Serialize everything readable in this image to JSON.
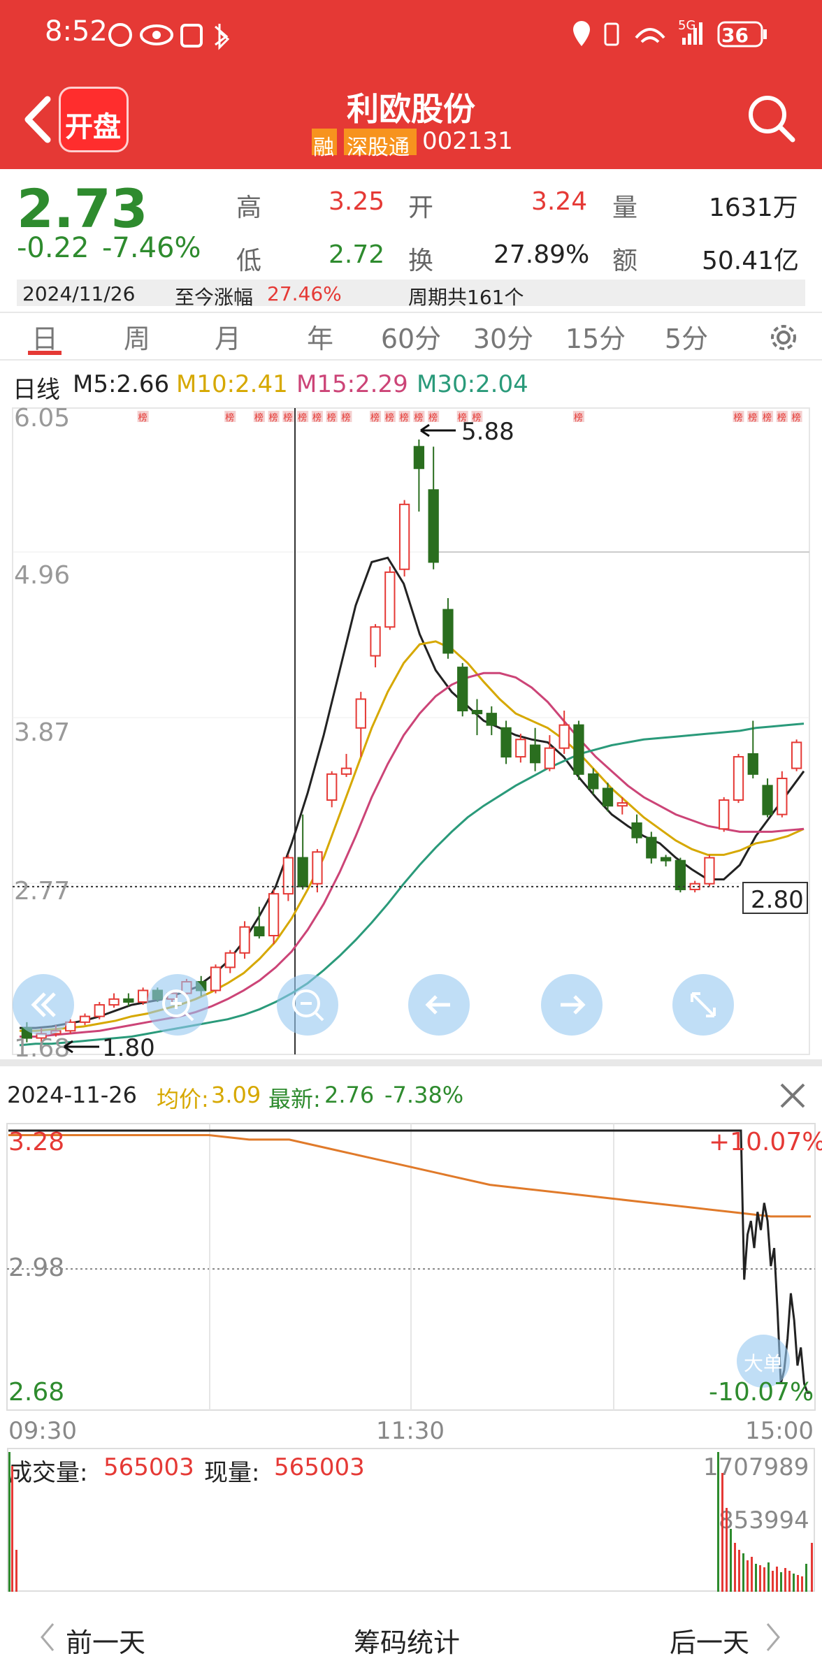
{
  "status_bar": {
    "time": "8:52",
    "battery": "36",
    "network": "5G"
  },
  "header": {
    "badge": "开盘",
    "stock_name": "利欧股份",
    "tag1": "融",
    "tag2": "深股通",
    "code": "002131"
  },
  "quote": {
    "price": "2.73",
    "change": "-0.22",
    "change_pct": "-7.46%",
    "high_label": "高",
    "high": "3.25",
    "open_label": "开",
    "open": "3.24",
    "vol_label": "量",
    "vol": "1631万",
    "low_label": "低",
    "low": "2.72",
    "turnover_label": "换",
    "turnover": "27.89%",
    "amount_label": "额",
    "amount": "50.41亿",
    "date": "2024/11/26",
    "gain_label": "至今涨幅",
    "gain": "27.46%",
    "period": "周期共161个"
  },
  "tabs": [
    "日",
    "周",
    "月",
    "年",
    "60分",
    "30分",
    "15分",
    "5分"
  ],
  "active_tab": "日",
  "ma_legend": {
    "type": "日线",
    "m5": "M5:2.66",
    "m10": "M10:2.41",
    "m15": "M15:2.29",
    "m30": "M30:2.04"
  },
  "colors": {
    "up": "#e53935",
    "down": "#2a6e1f",
    "m5": "#222222",
    "m10": "#d6a800",
    "m15": "#cc4477",
    "m30": "#2a9a7a",
    "header": "#e53935"
  },
  "kline_labels": {
    "hi_marker": "5.88",
    "lo_marker": "1.80",
    "current_box": "2.80",
    "bang": "榜"
  },
  "chart_data": [
    {
      "type": "candlestick",
      "title": "日线",
      "yticks": [
        "6.05",
        "4.96",
        "3.87",
        "2.77",
        "1.68"
      ],
      "ylim": [
        1.68,
        6.05
      ],
      "series": [
        {
          "name": "M5",
          "values": [
            1.82,
            1.82,
            1.83,
            1.85,
            1.87,
            1.9,
            1.94,
            1.98,
            2.0,
            2.02,
            2.06,
            2.1,
            2.18,
            2.28,
            2.42,
            2.6,
            2.8,
            3.1,
            3.45,
            3.85,
            4.3,
            4.75,
            5.05,
            5.08,
            4.9,
            4.55,
            4.3,
            4.15,
            4.05,
            3.95,
            3.9,
            3.85,
            3.82,
            3.8,
            3.7,
            3.55,
            3.42,
            3.3,
            3.22,
            3.15,
            3.1,
            3.0,
            2.92,
            2.85,
            2.85,
            2.95,
            3.15,
            3.3,
            3.45,
            3.6
          ]
        },
        {
          "name": "M10",
          "values": [
            1.8,
            1.8,
            1.81,
            1.82,
            1.83,
            1.85,
            1.87,
            1.9,
            1.92,
            1.95,
            1.98,
            2.02,
            2.07,
            2.13,
            2.2,
            2.3,
            2.42,
            2.58,
            2.78,
            3.0,
            3.3,
            3.6,
            3.9,
            4.15,
            4.35,
            4.48,
            4.5,
            4.45,
            4.35,
            4.22,
            4.1,
            4.0,
            3.95,
            3.9,
            3.82,
            3.72,
            3.6,
            3.48,
            3.38,
            3.28,
            3.2,
            3.12,
            3.06,
            3.02,
            3.02,
            3.05,
            3.1,
            3.12,
            3.15,
            3.2
          ]
        },
        {
          "name": "M15",
          "values": [
            1.76,
            1.76,
            1.77,
            1.78,
            1.79,
            1.8,
            1.82,
            1.84,
            1.86,
            1.88,
            1.9,
            1.93,
            1.97,
            2.02,
            2.08,
            2.15,
            2.24,
            2.35,
            2.5,
            2.68,
            2.9,
            3.15,
            3.42,
            3.65,
            3.85,
            4.0,
            4.12,
            4.2,
            4.25,
            4.28,
            4.28,
            4.25,
            4.18,
            4.08,
            3.95,
            3.82,
            3.7,
            3.6,
            3.5,
            3.42,
            3.36,
            3.3,
            3.26,
            3.22,
            3.2,
            3.18,
            3.18,
            3.18,
            3.19,
            3.2
          ]
        },
        {
          "name": "M30",
          "values": [
            1.7,
            1.71,
            1.71,
            1.72,
            1.73,
            1.74,
            1.75,
            1.76,
            1.78,
            1.8,
            1.82,
            1.84,
            1.86,
            1.88,
            1.91,
            1.95,
            2.0,
            2.06,
            2.13,
            2.22,
            2.32,
            2.43,
            2.55,
            2.68,
            2.82,
            2.95,
            3.07,
            3.18,
            3.28,
            3.36,
            3.43,
            3.5,
            3.56,
            3.62,
            3.67,
            3.72,
            3.75,
            3.78,
            3.8,
            3.82,
            3.83,
            3.84,
            3.85,
            3.86,
            3.87,
            3.88,
            3.9,
            3.91,
            3.92,
            3.93
          ]
        }
      ],
      "candles": [
        [
          1.82,
          1.75,
          1.86,
          1.72
        ],
        [
          1.75,
          1.78,
          1.82,
          1.72
        ],
        [
          1.78,
          1.8,
          1.84,
          1.76
        ],
        [
          1.8,
          1.86,
          1.88,
          1.78
        ],
        [
          1.86,
          1.9,
          1.92,
          1.84
        ],
        [
          1.9,
          1.98,
          2.0,
          1.88
        ],
        [
          1.98,
          2.02,
          2.06,
          1.96
        ],
        [
          2.02,
          2.0,
          2.06,
          1.97
        ],
        [
          2.0,
          2.08,
          2.1,
          1.98
        ],
        [
          2.08,
          2.02,
          2.1,
          2.0
        ],
        [
          2.02,
          2.06,
          2.08,
          1.98
        ],
        [
          2.06,
          2.14,
          2.16,
          2.04
        ],
        [
          2.14,
          2.08,
          2.18,
          2.04
        ],
        [
          2.08,
          2.24,
          2.26,
          2.06
        ],
        [
          2.24,
          2.34,
          2.36,
          2.2
        ],
        [
          2.34,
          2.52,
          2.56,
          2.3
        ],
        [
          2.52,
          2.46,
          2.66,
          2.44
        ],
        [
          2.46,
          2.75,
          2.78,
          2.4
        ],
        [
          2.75,
          3.0,
          3.02,
          2.7
        ],
        [
          3.0,
          2.8,
          3.3,
          2.78
        ],
        [
          2.82,
          3.04,
          3.06,
          2.76
        ],
        [
          3.4,
          3.58,
          3.6,
          3.35
        ],
        [
          3.58,
          3.62,
          3.72,
          3.56
        ],
        [
          3.9,
          4.1,
          4.15,
          3.7
        ],
        [
          4.4,
          4.6,
          4.62,
          4.32
        ],
        [
          4.6,
          4.98,
          5.02,
          4.58
        ],
        [
          5.0,
          5.45,
          5.48,
          4.95
        ],
        [
          5.85,
          5.7,
          5.9,
          5.4
        ],
        [
          5.55,
          5.05,
          5.85,
          5.0
        ],
        [
          4.72,
          4.42,
          4.8,
          4.38
        ],
        [
          4.32,
          4.02,
          4.35,
          3.98
        ],
        [
          4.02,
          4.0,
          4.1,
          3.85
        ],
        [
          4.0,
          3.92,
          4.05,
          3.85
        ],
        [
          3.9,
          3.7,
          3.95,
          3.65
        ],
        [
          3.7,
          3.82,
          3.86,
          3.66
        ],
        [
          3.78,
          3.66,
          3.9,
          3.6
        ],
        [
          3.62,
          3.76,
          3.85,
          3.6
        ],
        [
          3.76,
          3.92,
          4.02,
          3.72
        ],
        [
          3.92,
          3.58,
          3.95,
          3.54
        ],
        [
          3.58,
          3.48,
          3.62,
          3.44
        ],
        [
          3.48,
          3.36,
          3.52,
          3.32
        ],
        [
          3.36,
          3.38,
          3.42,
          3.3
        ],
        [
          3.24,
          3.14,
          3.3,
          3.1
        ],
        [
          3.14,
          3.0,
          3.18,
          2.96
        ],
        [
          3.0,
          2.98,
          3.02,
          2.94
        ],
        [
          2.98,
          2.78,
          3.0,
          2.76
        ],
        [
          2.78,
          2.82,
          2.84,
          2.76
        ],
        [
          2.82,
          3.0,
          3.02,
          2.8
        ],
        [
          3.2,
          3.4,
          3.42,
          3.18
        ],
        [
          3.4,
          3.7,
          3.72,
          3.38
        ],
        [
          3.72,
          3.58,
          3.95,
          3.55
        ],
        [
          3.5,
          3.3,
          3.55,
          3.28
        ],
        [
          3.3,
          3.55,
          3.6,
          3.28
        ],
        [
          3.62,
          3.8,
          3.82,
          3.6
        ]
      ]
    },
    {
      "type": "line",
      "title": "2024-11-26",
      "yticks_left": [
        "3.28",
        "2.98",
        "2.68"
      ],
      "yticks_right": [
        "+10.07%",
        "-10.07%"
      ],
      "xticks": [
        "09:30",
        "11:30",
        "15:00"
      ],
      "ylim": [
        2.68,
        3.28
      ],
      "series": [
        {
          "name": "价格",
          "values": [
            3.28,
            3.28,
            3.28,
            3.28,
            3.28,
            3.28,
            3.28,
            3.28,
            3.28,
            3.28,
            3.28,
            3.28,
            3.28,
            3.28,
            3.28,
            3.28,
            3.28,
            3.28,
            3.28,
            3.28,
            3.28,
            3.28,
            3.28,
            3.28,
            3.28,
            3.28,
            3.28,
            3.28,
            3.28,
            3.28,
            3.28,
            3.28,
            3.28,
            3.28,
            3.28,
            3.28,
            3.28,
            3.28,
            3.28,
            3.28,
            3.28,
            3.28,
            3.28,
            3.28,
            3.28,
            3.28,
            3.28,
            3.28,
            3.28,
            3.28,
            3.28,
            3.28,
            3.28,
            3.28,
            3.28,
            3.28,
            3.28,
            3.28,
            3.28,
            3.28,
            3.28,
            3.28,
            3.28,
            3.28,
            3.28,
            3.28,
            3.28,
            3.28,
            3.28,
            3.28,
            3.28,
            3.28,
            3.28,
            3.28,
            3.28,
            3.28,
            3.28,
            3.28,
            3.28,
            3.28,
            3.28,
            3.28,
            3.28,
            3.28,
            3.28,
            3.28,
            3.28,
            3.28,
            3.28,
            3.28,
            3.28,
            3.28,
            3.28,
            3.28,
            3.28,
            3.28,
            3.28,
            3.28,
            3.28,
            3.28,
            3.28,
            3.28,
            3.28,
            3.28,
            3.28,
            3.28,
            3.28,
            3.28,
            3.28,
            3.28,
            3.28,
            3.28,
            3.28,
            3.28,
            3.28,
            3.28,
            3.28,
            3.28,
            3.28,
            3.28,
            3.28,
            3.28,
            3.28,
            3.28,
            3.28,
            3.28,
            3.28,
            3.28,
            3.28,
            3.28,
            3.28,
            3.28,
            3.28,
            3.28,
            3.28,
            3.28,
            3.28,
            3.28,
            3.28,
            3.28,
            3.28,
            3.28,
            3.28,
            3.28,
            3.28,
            3.28,
            3.28,
            3.28,
            3.28,
            3.28,
            3.28,
            3.28,
            3.28,
            3.28,
            3.28,
            3.28,
            3.28,
            3.28,
            3.28,
            3.28,
            3.28,
            3.28,
            3.28,
            3.28,
            3.28,
            3.28,
            3.28,
            3.28,
            3.28,
            3.28,
            3.28,
            3.28,
            3.28,
            3.28,
            3.28,
            3.28,
            3.28,
            3.28,
            3.28,
            3.28,
            3.28,
            3.28,
            3.28,
            3.28,
            3.28,
            3.28,
            3.28,
            3.28,
            3.28,
            3.28,
            3.28,
            3.28,
            3.28,
            3.28,
            3.28,
            3.28,
            3.28,
            3.28,
            3.28,
            3.28,
            3.28,
            3.28,
            3.28,
            3.28,
            3.28,
            3.28,
            3.28,
            3.28,
            3.28,
            3.28,
            3.28,
            3.28,
            3.28,
            3.28,
            3.28,
            3.28,
            3.28,
            3.28,
            3.28,
            3.28,
            3.28,
            2.95,
            3.05,
            3.08,
            3.02,
            3.1,
            3.06,
            3.12,
            3.08,
            2.98,
            3.02,
            2.88,
            2.72,
            2.75,
            2.82,
            2.92,
            2.86,
            2.76,
            2.8,
            2.72,
            2.7,
            2.7
          ]
        },
        {
          "name": "均价",
          "values": [
            3.27,
            3.27,
            3.27,
            3.27,
            3.27,
            3.27,
            3.26,
            3.26,
            3.24,
            3.22,
            3.2,
            3.18,
            3.16,
            3.15,
            3.14,
            3.13,
            3.12,
            3.11,
            3.1,
            3.09,
            3.09
          ]
        }
      ]
    }
  ],
  "intraday": {
    "date": "2024-11-26",
    "avg_label": "均价:",
    "avg": "3.09",
    "last_label": "最新:",
    "last": "2.76",
    "last_pct": "-7.38%",
    "vol_label": "成交量:",
    "vol": "565003",
    "cur_label": "现量:",
    "cur": "565003",
    "vol_ticks": [
      "1707989",
      "853994"
    ],
    "big_order": "大单"
  },
  "bottom_nav": {
    "prev": "前一天",
    "middle": "筹码统计",
    "next": "后一天"
  }
}
